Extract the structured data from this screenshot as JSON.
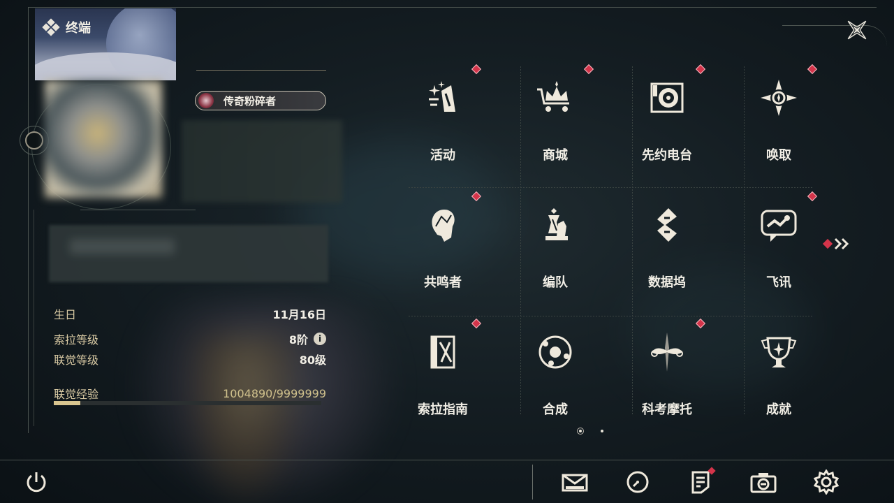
{
  "window": {
    "title": "终端"
  },
  "profile": {
    "title_badge": "传奇粉碎者"
  },
  "stats": {
    "birthday": {
      "label": "生日",
      "value": "11月16日"
    },
    "sola_level": {
      "label": "索拉等级",
      "value": "8阶",
      "info_icon": "i"
    },
    "union_level": {
      "label": "联觉等级",
      "value": "80级"
    },
    "union_exp": {
      "label": "联觉经验",
      "value": "1004890/9999999",
      "progress": 0.1005
    }
  },
  "menu": [
    {
      "label": "活动",
      "icon": "sparkle-book-icon",
      "badge": true
    },
    {
      "label": "商城",
      "icon": "crown-cart-icon",
      "badge": true
    },
    {
      "label": "先约电台",
      "icon": "radio-icon",
      "badge": true
    },
    {
      "label": "唤取",
      "icon": "compass-star-icon",
      "badge": true
    },
    {
      "label": "共鸣者",
      "icon": "character-head-icon",
      "badge": true
    },
    {
      "label": "编队",
      "icon": "chess-pieces-icon",
      "badge": false
    },
    {
      "label": "数据坞",
      "icon": "data-dock-icon",
      "badge": false
    },
    {
      "label": "飞讯",
      "icon": "chat-bubble-icon",
      "badge": true
    },
    {
      "label": "索拉指南",
      "icon": "guide-book-icon",
      "badge": true
    },
    {
      "label": "合成",
      "icon": "orbit-icon",
      "badge": false
    },
    {
      "label": "科考摩托",
      "icon": "motorbike-icon",
      "badge": true
    },
    {
      "label": "成就",
      "icon": "trophy-icon",
      "badge": false
    }
  ],
  "pager": {
    "current": 1,
    "total": 2
  },
  "bottom_bar": [
    {
      "icon": "mail-icon",
      "badge": false
    },
    {
      "icon": "clock-icon",
      "badge": false
    },
    {
      "icon": "notice-icon",
      "badge": true
    },
    {
      "icon": "camera-icon",
      "badge": false
    },
    {
      "icon": "settings-icon",
      "badge": false
    }
  ],
  "colors": {
    "accent": "#d9c58f",
    "badge_red": "#d4344a",
    "text": "#f2efe6"
  }
}
